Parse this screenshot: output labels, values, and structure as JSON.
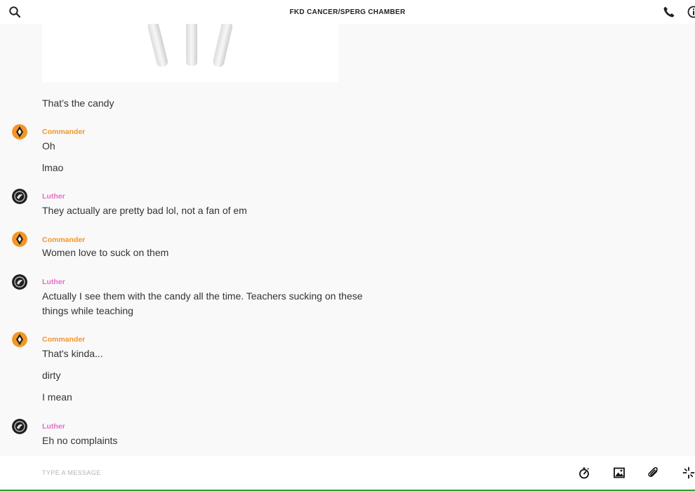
{
  "header": {
    "title": "FKD CANCER/SPERG CHAMBER",
    "icons": [
      "search-icon",
      "phone-icon",
      "info-icon"
    ]
  },
  "colors": {
    "commander": "#f29627",
    "luther": "#e371c3",
    "accent_line": "#2f9e2f"
  },
  "messages": [
    {
      "author": "",
      "lines": [
        "That’s the candy"
      ]
    },
    {
      "author": "Commander",
      "lines": [
        "Oh",
        "lmao"
      ]
    },
    {
      "author": "Luther",
      "lines": [
        "They actually are pretty bad lol, not a fan of em"
      ]
    },
    {
      "author": "Commander",
      "lines": [
        "Women love to suck on them"
      ]
    },
    {
      "author": "Luther",
      "lines": [
        "Actually I see them with the candy all the time. Teachers sucking on these",
        "things while teaching"
      ]
    },
    {
      "author": "Commander",
      "lines": [
        "That's kinda...",
        "dirty",
        "I mean"
      ]
    },
    {
      "author": "Luther",
      "lines": [
        "Eh no complaints"
      ]
    }
  ],
  "composer": {
    "placeholder": "TYPE A MESSAGE",
    "tools": [
      "timer-icon",
      "image-icon",
      "attachment-icon",
      "sparkle-icon"
    ]
  }
}
